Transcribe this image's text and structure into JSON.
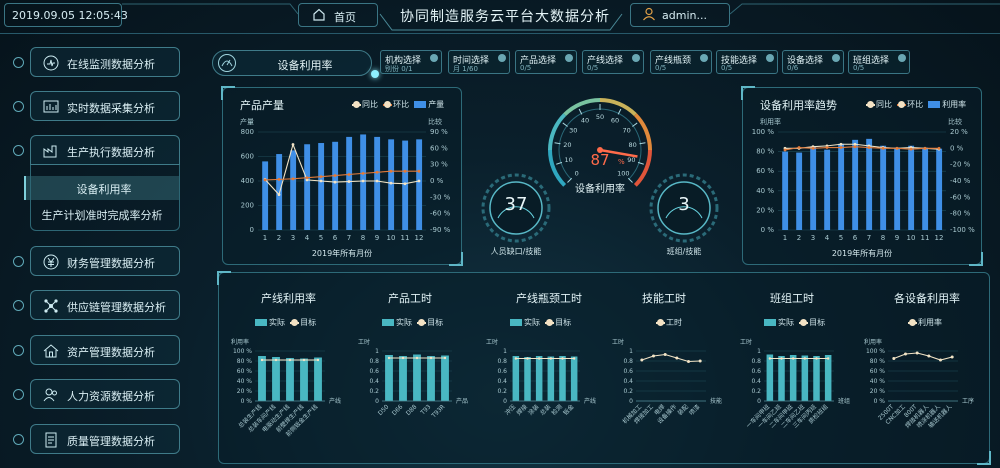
{
  "header": {
    "datetime": "2019.09.05 12:05:43",
    "home": "首页",
    "title": "协同制造服务云平台大数据分析",
    "user": "admin..."
  },
  "nav": [
    {
      "label": "在线监测数据分析",
      "icon": "monitor-icon"
    },
    {
      "label": "实时数据采集分析",
      "icon": "chart-icon"
    },
    {
      "label": "生产执行数据分析",
      "icon": "factory-icon"
    },
    {
      "label": "财务管理数据分析",
      "icon": "finance-icon"
    },
    {
      "label": "供应链管理数据分析",
      "icon": "network-icon"
    },
    {
      "label": "资产管理数据分析",
      "icon": "house-icon"
    },
    {
      "label": "人力资源数据分析",
      "icon": "people-icon"
    },
    {
      "label": "质量管理数据分析",
      "icon": "document-icon"
    }
  ],
  "subnav": {
    "active": "设备利用率",
    "other": "生产计划准时完成率分析"
  },
  "page_tab": "设备利用率",
  "filters": [
    {
      "label": "机构选择",
      "sub": "别份 0/1"
    },
    {
      "label": "时间选择",
      "sub": "月 1/60"
    },
    {
      "label": "产品选择",
      "sub": "0/5"
    },
    {
      "label": "产线选择",
      "sub": "0/5"
    },
    {
      "label": "产线瓶颈",
      "sub": "0/5"
    },
    {
      "label": "技能选择",
      "sub": "0/5"
    },
    {
      "label": "设备选择",
      "sub": "0/6"
    },
    {
      "label": "班组选择",
      "sub": "0/5"
    }
  ],
  "colors": {
    "bar": "#3f8fe6",
    "teal": "#49b7c2",
    "orange": "#e07a3a",
    "cream": "#f2e4c6",
    "panel_border": "#2d6a78"
  },
  "gauge": {
    "value": "87",
    "unit": "%",
    "label": "设备利用率",
    "ticks": [
      "0",
      "10",
      "20",
      "30",
      "40",
      "50",
      "60",
      "70",
      "80",
      "90",
      "100"
    ]
  },
  "dial_left": {
    "value": "37",
    "label": "人员缺口/技能"
  },
  "dial_right": {
    "value": "3",
    "label": "班组/技能"
  },
  "chart_data": [
    {
      "id": "output",
      "type": "bar",
      "title": "产品产量",
      "ylabel": "产量",
      "y2label": "比较",
      "xlabel": "2019年所有月份",
      "legend": [
        "同比",
        "环比",
        "产量"
      ],
      "yticks": [
        "0",
        "200",
        "400",
        "600",
        "800"
      ],
      "y2ticks": [
        "-90 %",
        "-60 %",
        "-30 %",
        "0 %",
        "30 %",
        "60 %",
        "90 %"
      ],
      "ylim": [
        0,
        800
      ],
      "y2lim": [
        -90,
        90
      ],
      "categories": [
        "1",
        "2",
        "3",
        "4",
        "5",
        "6",
        "7",
        "8",
        "9",
        "10",
        "11",
        "12"
      ],
      "series": [
        {
          "name": "产量",
          "values": [
            560,
            620,
            650,
            700,
            710,
            720,
            760,
            780,
            760,
            740,
            730,
            740
          ]
        },
        {
          "name": "同比",
          "values": [
            3,
            -25,
            67,
            2,
            0,
            -2,
            -1,
            0,
            0,
            -4,
            -5,
            0
          ]
        },
        {
          "name": "环比",
          "values": [
            2,
            3,
            4,
            6,
            8,
            10,
            12,
            14,
            16,
            18,
            18,
            18
          ]
        }
      ]
    },
    {
      "id": "util_trend",
      "type": "bar",
      "title": "设备利用率趋势",
      "ylabel": "利用率",
      "y2label": "比较",
      "xlabel": "2019年所有月份",
      "legend": [
        "同比",
        "环比",
        "利用率"
      ],
      "yticks": [
        "0 %",
        "20 %",
        "40 %",
        "60 %",
        "80 %",
        "100 %"
      ],
      "y2ticks": [
        "-100 %",
        "-80 %",
        "-60 %",
        "-40 %",
        "-20 %",
        "0 %",
        "20 %"
      ],
      "ylim": [
        0,
        100
      ],
      "y2lim": [
        -100,
        20
      ],
      "categories": [
        "1",
        "2",
        "3",
        "4",
        "5",
        "6",
        "7",
        "8",
        "9",
        "10",
        "11",
        "12"
      ],
      "series": [
        {
          "name": "利用率",
          "values": [
            80,
            79,
            85,
            82,
            88,
            92,
            93,
            86,
            84,
            86,
            84,
            83
          ]
        },
        {
          "name": "同比",
          "values": [
            0,
            0,
            2,
            3,
            5,
            5,
            3,
            1,
            0,
            1,
            0,
            -1
          ]
        },
        {
          "name": "环比",
          "values": [
            -2,
            1,
            0,
            1,
            1,
            2,
            1,
            0,
            0,
            -1,
            0,
            0
          ]
        }
      ]
    },
    {
      "id": "line_util",
      "type": "bar",
      "title": "产线利用率",
      "ylabel": "利用率",
      "xlabel": "产线",
      "legend": [
        "实际",
        "目标"
      ],
      "yticks": [
        "0 %",
        "20 %",
        "40 %",
        "60 %",
        "80 %",
        "100 %"
      ],
      "ylim": [
        0,
        100
      ],
      "categories": [
        "总装生产线",
        "总装车间产线",
        "电驱动生产线",
        "前壁焊生产线",
        "前侧钣金生产线"
      ],
      "series": [
        {
          "name": "实际",
          "values": [
            90,
            88,
            86,
            85,
            87
          ]
        },
        {
          "name": "目标",
          "values": [
            82,
            82,
            82,
            82,
            82
          ]
        }
      ]
    },
    {
      "id": "product_hours",
      "type": "bar",
      "title": "产品工时",
      "ylabel": "工时",
      "xlabel": "产品",
      "legend": [
        "实际",
        "目标"
      ],
      "yticks": [
        "0",
        "0.2",
        "0.4",
        "0.6",
        "0.8",
        "1"
      ],
      "ylim": [
        0,
        1
      ],
      "categories": [
        "D50",
        "D66",
        "D88",
        "T93",
        "T93R"
      ],
      "series": [
        {
          "name": "实际",
          "values": [
            0.92,
            0.9,
            0.93,
            0.9,
            0.91
          ]
        },
        {
          "name": "目标",
          "values": [
            0.86,
            0.86,
            0.86,
            0.86,
            0.86
          ]
        }
      ]
    },
    {
      "id": "bottleneck_hours",
      "type": "bar",
      "title": "产线瓶颈工时",
      "ylabel": "工时",
      "xlabel": "产线",
      "legend": [
        "实际",
        "目标"
      ],
      "yticks": [
        "0",
        "0.2",
        "0.4",
        "0.6",
        "0.8",
        "1"
      ],
      "ylim": [
        0,
        1
      ],
      "categories": [
        "冲压",
        "焊接",
        "涂装",
        "总装",
        "检测",
        "钣金"
      ],
      "series": [
        {
          "name": "实际",
          "values": [
            0.9,
            0.88,
            0.9,
            0.89,
            0.9,
            0.89
          ]
        },
        {
          "name": "目标",
          "values": [
            0.85,
            0.85,
            0.85,
            0.85,
            0.85,
            0.85
          ]
        }
      ]
    },
    {
      "id": "skill_hours",
      "type": "line",
      "title": "技能工时",
      "ylabel": "工时",
      "xlabel": "技能",
      "legend": [
        "工时"
      ],
      "yticks": [
        "0",
        "0.2",
        "0.4",
        "0.6",
        "0.8",
        "1"
      ],
      "ylim": [
        0,
        1
      ],
      "categories": [
        "机械加工",
        "焊接加工",
        "电焊",
        "设备操作",
        "装配",
        "喷漆"
      ],
      "series": [
        {
          "name": "工时",
          "values": [
            0.82,
            0.9,
            0.93,
            0.86,
            0.79,
            0.8
          ]
        }
      ]
    },
    {
      "id": "team_hours",
      "type": "bar",
      "title": "班组工时",
      "ylabel": "工时",
      "xlabel": "班组",
      "legend": [
        "实际",
        "目标"
      ],
      "yticks": [
        "0",
        "0.2",
        "0.4",
        "0.6",
        "0.8",
        "1"
      ],
      "ylim": [
        0,
        1
      ],
      "categories": [
        "一车间甲班",
        "一车间乙班",
        "二车间甲班",
        "二车间乙班",
        "三车间丙班",
        "质检班组"
      ],
      "series": [
        {
          "name": "实际",
          "values": [
            0.93,
            0.9,
            0.92,
            0.91,
            0.9,
            0.92
          ]
        },
        {
          "name": "目标",
          "values": [
            0.85,
            0.85,
            0.85,
            0.85,
            0.85,
            0.85
          ]
        }
      ]
    },
    {
      "id": "equip_util",
      "type": "line",
      "title": "各设备利用率",
      "ylabel": "利用率",
      "xlabel": "工序",
      "legend": [
        "利用率"
      ],
      "yticks": [
        "0 %",
        "20 %",
        "40 %",
        "60 %",
        "80 %",
        "100 %"
      ],
      "ylim": [
        0,
        100
      ],
      "categories": [
        "2500T",
        "CNC加工",
        "800T",
        "焊接机器人",
        "喷涂机器人",
        "输送机器人"
      ],
      "series": [
        {
          "name": "利用率",
          "values": [
            85,
            94,
            96,
            90,
            82,
            88
          ]
        }
      ]
    }
  ]
}
